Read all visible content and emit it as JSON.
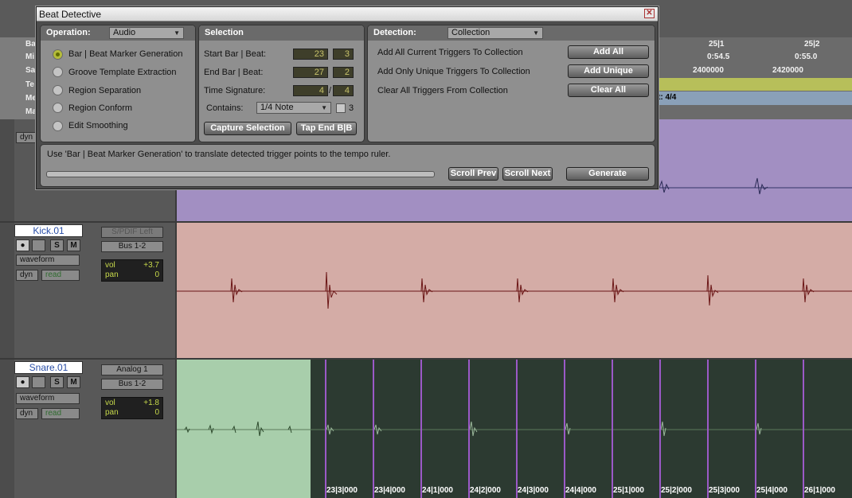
{
  "background": {
    "rulers": [
      {
        "name": "Ba",
        "values": [
          "25|1",
          "25|2"
        ]
      },
      {
        "name": "Mi",
        "values": [
          "0:54.5",
          "0:55.0"
        ]
      },
      {
        "name": "Sa",
        "values": [
          "2400000",
          "2420000"
        ]
      },
      {
        "name": "Te",
        "values": []
      },
      {
        "name": "Me",
        "values": [
          "t: 4/4"
        ]
      },
      {
        "name": "Ma",
        "values": []
      }
    ],
    "tracks": {
      "kick": {
        "name": "Kick.01",
        "view": "waveform",
        "dyn": "dyn",
        "automation": "read",
        "input": "S/PDIF Left",
        "output": "Bus 1-2",
        "vol_label": "vol",
        "vol": "+3.7",
        "pan_label": "pan",
        "pan": "0"
      },
      "snare": {
        "name": "Snare.01",
        "view": "waveform",
        "dyn": "dyn",
        "automation": "read",
        "input": "Analog 1",
        "output": "Bus 1-2",
        "vol_label": "vol",
        "vol": "+1.8",
        "pan_label": "pan",
        "pan": "0"
      },
      "top": {
        "dyn": "dyn"
      }
    },
    "solo_label": "S",
    "mute_label": "M",
    "beat_labels": [
      "23|3|000",
      "23|4|000",
      "24|1|000",
      "24|2|000",
      "24|3|000",
      "24|4|000",
      "25|1|000",
      "25|2|000",
      "25|3|000",
      "25|4|000",
      "26|1|000"
    ],
    "colors": {
      "top_track": "#a28fc2",
      "kick_track": "#d4aca6",
      "snare_selected": "#a8ceab",
      "snare_rest": "#2c3a31",
      "marker": "#9b59c7"
    }
  },
  "dialog": {
    "title": "Beat Detective",
    "operation": {
      "header": "Operation:",
      "selected": "Audio",
      "options": [
        {
          "label": "Bar | Beat Marker Generation",
          "selected": true
        },
        {
          "label": "Groove Template Extraction",
          "selected": false
        },
        {
          "label": "Region Separation",
          "selected": false
        },
        {
          "label": "Region Conform",
          "selected": false
        },
        {
          "label": "Edit Smoothing",
          "selected": false
        }
      ]
    },
    "selection": {
      "header": "Selection",
      "start_label": "Start Bar | Beat:",
      "start_bar": "23",
      "start_beat": "3",
      "end_label": "End Bar | Beat:",
      "end_bar": "27",
      "end_beat": "2",
      "timesig_label": "Time Signature:",
      "timesig_num": "4",
      "timesig_sep": "/",
      "timesig_den": "4",
      "contains_label": "Contains:",
      "contains_value": "1/4 Note",
      "triplet_label": "3",
      "capture_button": "Capture Selection",
      "tap_button": "Tap End B|B"
    },
    "detection": {
      "header": "Detection:",
      "mode": "Collection",
      "rows": [
        {
          "text": "Add All Current Triggers To Collection",
          "button": "Add All"
        },
        {
          "text": "Add Only Unique Triggers To Collection",
          "button": "Add Unique"
        },
        {
          "text": "Clear All Triggers From Collection",
          "button": "Clear All"
        }
      ]
    },
    "footer": {
      "message": "Use 'Bar | Beat Marker Generation' to translate detected trigger points to the tempo ruler.",
      "scroll_prev": "Scroll Prev",
      "scroll_next": "Scroll Next",
      "generate": "Generate",
      "progress": 0
    }
  }
}
